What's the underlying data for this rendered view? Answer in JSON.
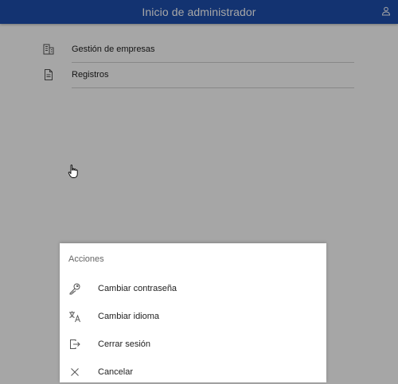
{
  "header": {
    "title": "Inicio de administrador",
    "user_icon": "user-icon"
  },
  "menu": {
    "items": [
      {
        "label": "Gestión de empresas",
        "icon": "building-icon"
      },
      {
        "label": "Registros",
        "icon": "document-icon"
      }
    ]
  },
  "action_sheet": {
    "title": "Acciones",
    "actions": [
      {
        "label": "Cambiar contraseña",
        "icon": "key-icon"
      },
      {
        "label": "Cambiar idioma",
        "icon": "translate-icon"
      },
      {
        "label": "Cerrar sesión",
        "icon": "logout-icon"
      },
      {
        "label": "Cancelar",
        "icon": "close-icon"
      }
    ]
  },
  "colors": {
    "header_bg": "#1e4fae",
    "overlay": "rgba(0,0,0,0.35)",
    "icon": "#555555"
  }
}
